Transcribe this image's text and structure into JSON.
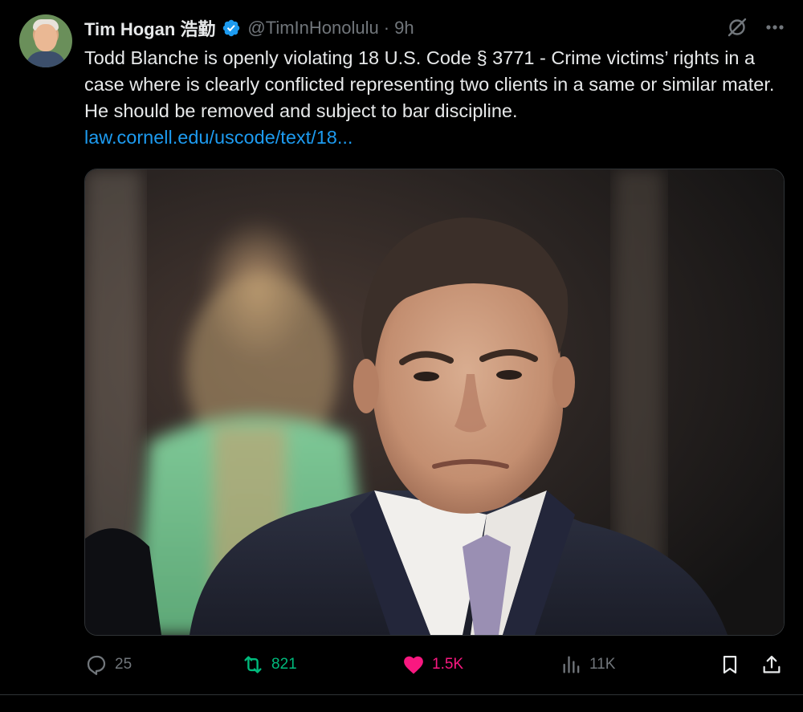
{
  "tweet": {
    "author": {
      "name": "Tim Hogan 浩勤",
      "handle": "@TimInHonolulu",
      "separator": "·",
      "time": "9h",
      "verified": true,
      "avatar_icon": "profile-photo"
    },
    "text_lines": [
      "Todd Blanche is openly violating 18 U.S. Code § 3771 - Crime victims’ rights in a case where is clearly conflicted representing two clients in a same or similar mater. He should be removed and subject to bar discipline."
    ],
    "link_text": "law.cornell.edu/uscode/text/18...",
    "media": {
      "kind": "photo",
      "description_icon": "man-in-suit-photo"
    },
    "actions": {
      "replies": "25",
      "reposts": "821",
      "likes": "1.5K",
      "views": "11K"
    },
    "colors": {
      "background": "#000000",
      "text": "#e7e9ea",
      "muted": "#71767b",
      "link": "#1d9bf0",
      "verified": "#1d9bf0",
      "repost": "#00ba7c",
      "like": "#f91880"
    },
    "icons": {
      "reply": "reply-icon",
      "repost": "repost-icon",
      "like": "heart-icon",
      "views": "views-chart-icon",
      "bookmark": "bookmark-icon",
      "share": "share-icon",
      "grok": "grok-icon",
      "more": "more-dots-icon"
    }
  }
}
